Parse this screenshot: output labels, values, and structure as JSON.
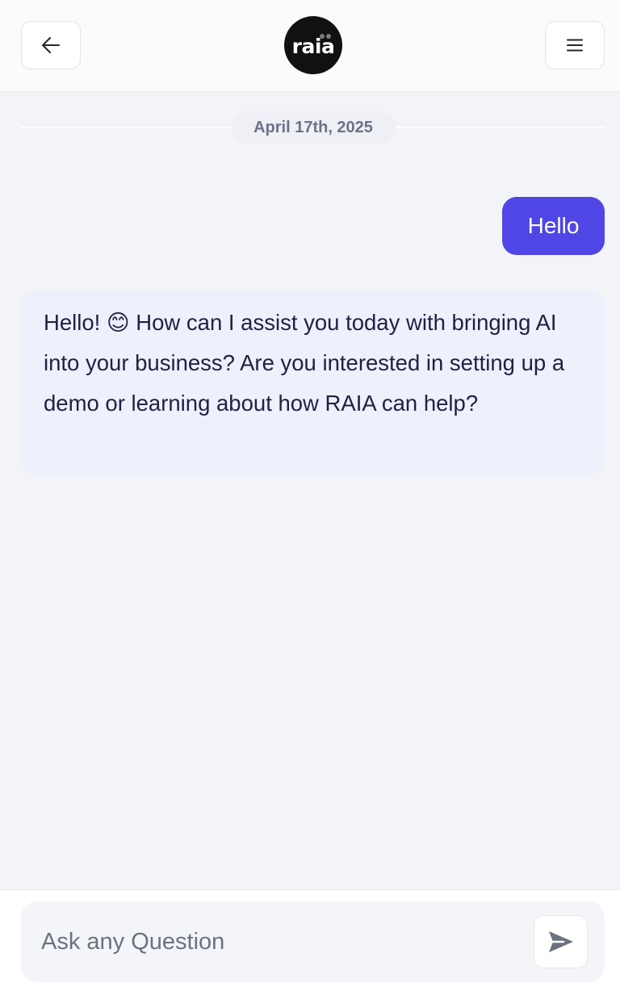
{
  "header": {
    "back_icon": "arrow-left-icon",
    "menu_icon": "hamburger-menu-icon",
    "logo_text": "raia"
  },
  "chat": {
    "date_label": "April 17th, 2025",
    "messages": [
      {
        "role": "user",
        "text": "Hello"
      },
      {
        "role": "assistant",
        "text": "Hello! 😊 How can I assist you today with bringing AI into your business? Are you interested in setting up a demo or learning about how RAIA can help?"
      }
    ]
  },
  "composer": {
    "placeholder": "Ask any Question",
    "value": "",
    "send_icon": "send-icon"
  },
  "colors": {
    "accent": "#4f46e5",
    "assistant_bubble": "#eef0fc",
    "background": "#f3f4f7"
  }
}
